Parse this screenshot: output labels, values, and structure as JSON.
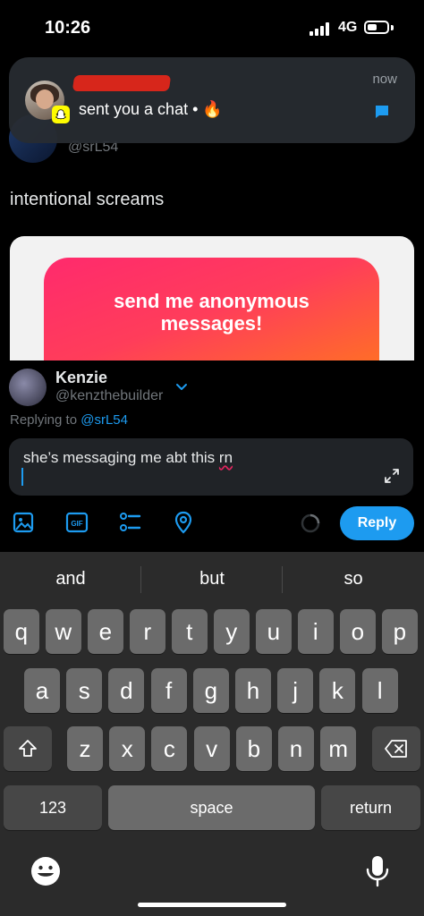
{
  "status_bar": {
    "time": "10:26",
    "network": "4G"
  },
  "tweet": {
    "handle": "@srL54",
    "text": "intentional screams",
    "card_text_line1": "send me anonymous",
    "card_text_line2": "messages!"
  },
  "notification": {
    "app_icon": "snapchat-icon",
    "body": "sent you a chat • 🔥",
    "time": "now"
  },
  "reply": {
    "user_name": "Kenzie",
    "user_handle": "@kenzthebuilder",
    "replying_prefix": "Replying to",
    "replying_handle": "@srL54",
    "draft_text_main": "she’s messaging me abt this ",
    "draft_text_flagged": "rn",
    "button_label": "Reply",
    "tools": [
      "image-icon",
      "gif-icon",
      "poll-icon",
      "location-icon"
    ]
  },
  "keyboard": {
    "suggestions": [
      "and",
      "but",
      "so"
    ],
    "row1": [
      "q",
      "w",
      "e",
      "r",
      "t",
      "y",
      "u",
      "i",
      "o",
      "p"
    ],
    "row2": [
      "a",
      "s",
      "d",
      "f",
      "g",
      "h",
      "j",
      "k",
      "l"
    ],
    "row3": [
      "z",
      "x",
      "c",
      "v",
      "b",
      "n",
      "m"
    ],
    "numbers_label": "123",
    "space_label": "space",
    "return_label": "return"
  },
  "colors": {
    "accent": "#1d9bf0",
    "background": "#000000",
    "keyboard": "#2b2b2b"
  }
}
